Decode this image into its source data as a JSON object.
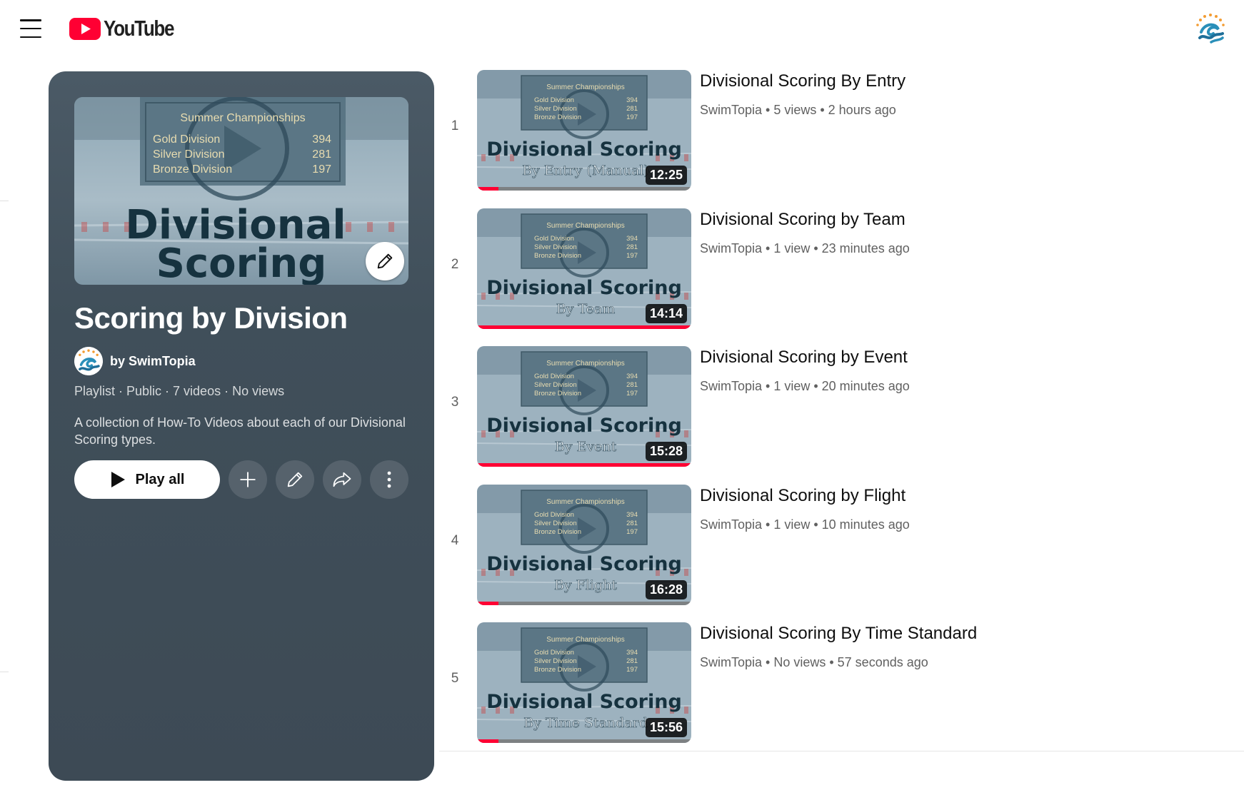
{
  "header": {
    "logo_text": "YouTube",
    "menu_icon": "hamburger-menu-icon",
    "avatar_icon": "channel-avatar"
  },
  "playlist": {
    "thumbnail": {
      "board_title": "Summer Championships",
      "rows": [
        {
          "label": "Gold Division",
          "value": "394"
        },
        {
          "label": "Silver Division",
          "value": "281"
        },
        {
          "label": "Bronze Division",
          "value": "197"
        }
      ],
      "big_line1": "Divisional",
      "big_line2": "Scoring"
    },
    "title": "Scoring by Division",
    "owner": "by SwimTopia",
    "meta": "Playlist · Public · 7 videos · No views",
    "description": "A collection of How-To Videos about each of our Divisional Scoring types.",
    "play_all_label": "Play all"
  },
  "videos": [
    {
      "index": "1",
      "title": "Divisional Scoring By Entry",
      "meta": "SwimTopia • 5 views • 2 hours ago",
      "duration": "12:25",
      "subtitle": "By Entry (Manual)",
      "progress": 0.1
    },
    {
      "index": "2",
      "title": "Divisional Scoring by Team",
      "meta": "SwimTopia • 1 view • 23 minutes ago",
      "duration": "14:14",
      "subtitle": "By Team",
      "progress": 1.0
    },
    {
      "index": "3",
      "title": "Divisional Scoring by Event",
      "meta": "SwimTopia • 1 view • 20 minutes ago",
      "duration": "15:28",
      "subtitle": "By Event",
      "progress": 1.0
    },
    {
      "index": "4",
      "title": "Divisional Scoring by Flight",
      "meta": "SwimTopia • 1 view • 10 minutes ago",
      "duration": "16:28",
      "subtitle": "By Flight",
      "progress": 0.1
    },
    {
      "index": "5",
      "title": "Divisional Scoring By Time Standard",
      "meta": "SwimTopia • No views • 57 seconds ago",
      "duration": "15:56",
      "subtitle": "By Time Standard",
      "progress": 0.1
    }
  ],
  "thumb_common": {
    "board_title": "Summer Championships",
    "rows": [
      {
        "label": "Gold Division",
        "value": "394"
      },
      {
        "label": "Silver Division",
        "value": "281"
      },
      {
        "label": "Bronze Division",
        "value": "197"
      }
    ],
    "big_text": "Divisional Scoring"
  },
  "colors": {
    "brand_red": "#ff0033",
    "panel_bg": "#404f5a",
    "thumb_text": "#16323f"
  }
}
